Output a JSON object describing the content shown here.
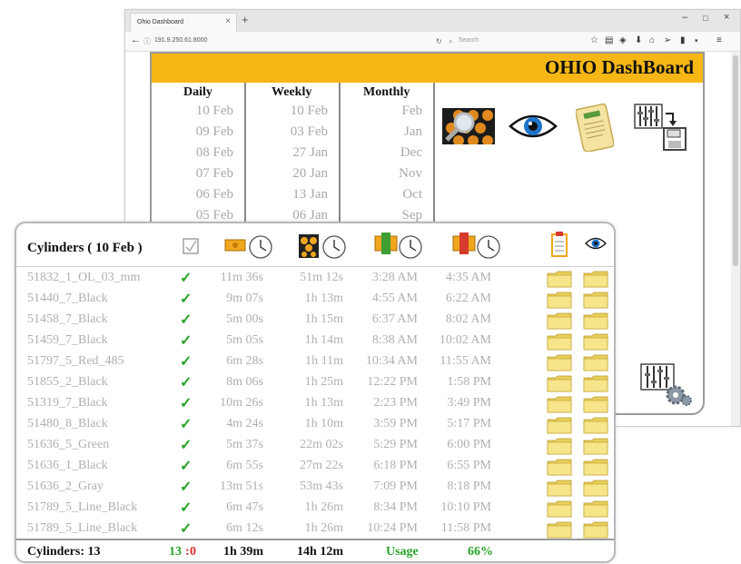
{
  "browser": {
    "tab_title": "Ohio Dashboard",
    "tab_close": "×",
    "new_tab": "+",
    "url": "191.9.250.61:8000",
    "search_placeholder": "Search",
    "window_controls": [
      "–",
      "□",
      "×"
    ]
  },
  "dashboard": {
    "title": "OHIO DashBoard",
    "columns": [
      {
        "heading": "Daily",
        "items": [
          "10 Feb",
          "09 Feb",
          "08 Feb",
          "07 Feb",
          "06 Feb",
          "05 Feb"
        ]
      },
      {
        "heading": "Weekly",
        "items": [
          "10 Feb",
          "03 Feb",
          "27 Jan",
          "20 Jan",
          "13 Jan",
          "06 Jan"
        ]
      },
      {
        "heading": "Monthly",
        "items": [
          "Feb",
          "Jan",
          "Dec",
          "Nov",
          "Oct",
          "Sep"
        ]
      }
    ],
    "icons": [
      "search-report-icon",
      "eye-icon",
      "scroll-document-icon",
      "export-save-icon",
      "settings-equalizer-icon"
    ]
  },
  "cylinders": {
    "title": "Cylinders ( 10 Feb )",
    "check_mark": "✓",
    "rows": [
      {
        "name": "51832_1_OL_03_mm",
        "t1": "11m 36s",
        "t2": "51m 12s",
        "start": "3:28 AM",
        "end": "4:35 AM"
      },
      {
        "name": "51440_7_Black",
        "t1": "9m 07s",
        "t2": "1h 13m",
        "start": "4:55 AM",
        "end": "6:22 AM"
      },
      {
        "name": "51458_7_Black",
        "t1": "5m 00s",
        "t2": "1h 15m",
        "start": "6:37 AM",
        "end": "8:02 AM"
      },
      {
        "name": "51459_7_Black",
        "t1": "5m 05s",
        "t2": "1h 14m",
        "start": "8:38 AM",
        "end": "10:02 AM"
      },
      {
        "name": "51797_5_Red_485",
        "t1": "6m 28s",
        "t2": "1h 11m",
        "start": "10:34 AM",
        "end": "11:55 AM"
      },
      {
        "name": "51855_2_Black",
        "t1": "8m 06s",
        "t2": "1h 25m",
        "start": "12:22 PM",
        "end": "1:58 PM"
      },
      {
        "name": "51319_7_Black",
        "t1": "10m 26s",
        "t2": "1h 13m",
        "start": "2:23 PM",
        "end": "3:49 PM"
      },
      {
        "name": "51480_8_Black",
        "t1": "4m 24s",
        "t2": "1h 10m",
        "start": "3:59 PM",
        "end": "5:17 PM"
      },
      {
        "name": "51636_5_Green",
        "t1": "5m 37s",
        "t2": "22m 02s",
        "start": "5:29 PM",
        "end": "6:00 PM"
      },
      {
        "name": "51636_1_Black",
        "t1": "6m 55s",
        "t2": "27m 22s",
        "start": "6:18 PM",
        "end": "6:55 PM"
      },
      {
        "name": "51636_2_Gray",
        "t1": "13m 51s",
        "t2": "53m 43s",
        "start": "7:09 PM",
        "end": "8:18 PM"
      },
      {
        "name": "51789_5_Line_Black",
        "t1": "6m 47s",
        "t2": "1h 26m",
        "start": "8:34 PM",
        "end": "10:10 PM"
      },
      {
        "name": "51789_5_Line_Black",
        "t1": "6m 12s",
        "t2": "1h 26m",
        "start": "10:24 PM",
        "end": "11:58 PM"
      }
    ],
    "footer": {
      "count_label": "Cylinders: 13",
      "ok": "13",
      "sep": ":",
      "fail": "0",
      "total_t1": "1h 39m",
      "total_t2": "14h 12m",
      "usage_label": "Usage",
      "usage_value": "66%"
    }
  },
  "colors": {
    "header_yellow": "#f6b716",
    "check_green": "#29a329",
    "fail_red": "#d62d2d",
    "usage_green": "#29a329",
    "muted_text": "#b0b0b0"
  }
}
